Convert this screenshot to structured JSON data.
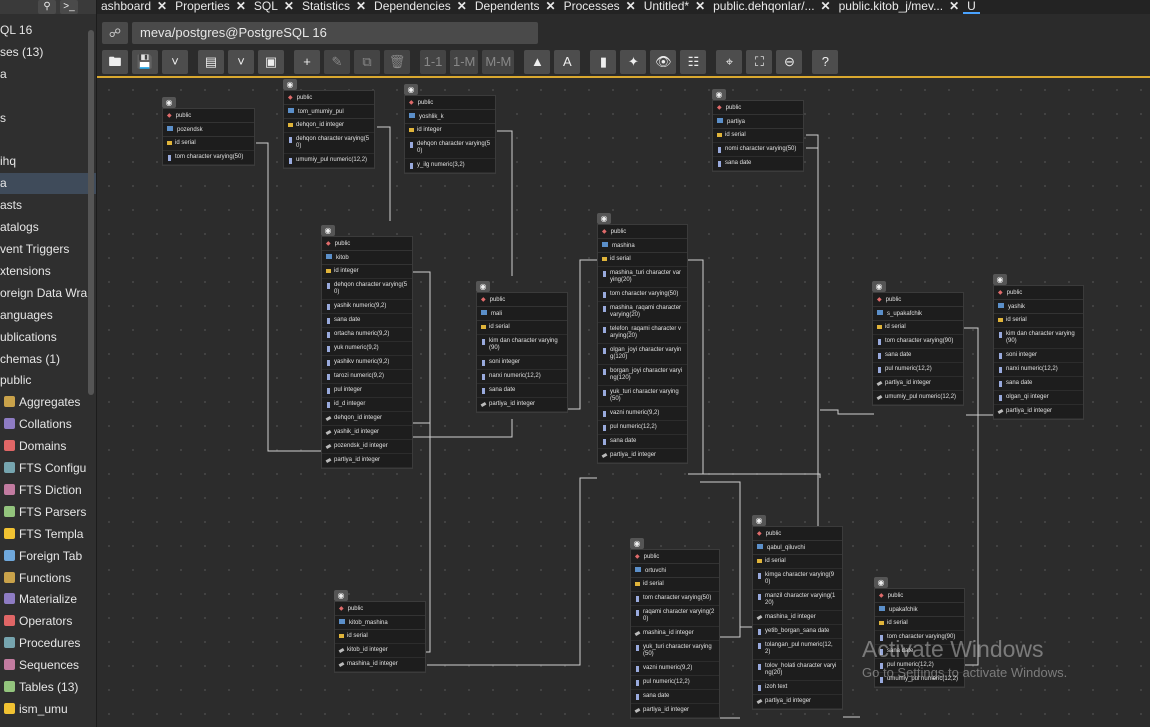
{
  "tabs": [
    {
      "label": "ashboard"
    },
    {
      "label": "Properties"
    },
    {
      "label": "SQL"
    },
    {
      "label": "Statistics"
    },
    {
      "label": "Dependencies"
    },
    {
      "label": "Dependents"
    },
    {
      "label": "Processes"
    },
    {
      "label": "Untitled*"
    },
    {
      "label": "public.dehqonlar/..."
    },
    {
      "label": "public.kitob_j/mev..."
    },
    {
      "label": "U"
    }
  ],
  "connection": "meva/postgres@PostgreSQL 16",
  "toolbar": {
    "one_one": "1-1",
    "one_many": "1-M",
    "many_many": "M-M",
    "help": "?"
  },
  "tree": [
    "QL 16",
    "ses (13)",
    "a",
    "",
    "s",
    "",
    "ihq",
    "a",
    "asts",
    "atalogs",
    "vent Triggers",
    "xtensions",
    "oreign Data Wra",
    "anguages",
    "ublications",
    "chemas (1)",
    "public",
    "Aggregates",
    "Collations",
    "Domains",
    "FTS Configu",
    "FTS Diction",
    "FTS Parsers",
    "FTS Templa",
    "Foreign Tab",
    "Functions",
    "Materialize",
    "Operators",
    "Procedures",
    "Sequences",
    "Tables (13)",
    "ism_umu"
  ],
  "tables": [
    {
      "id": "t1",
      "schema": "public",
      "name": "pozendsk",
      "cols": [
        {
          "n": "id serial",
          "k": "pk"
        },
        {
          "n": "tom character varying(50)",
          "k": ""
        }
      ]
    },
    {
      "id": "t2",
      "schema": "public",
      "name": "tom_umumiy_pul",
      "cols": [
        {
          "n": "dehqon_id integer",
          "k": "pk"
        },
        {
          "n": "dehqon character varying(50)",
          "k": ""
        },
        {
          "n": "umumiy_pul numeric(12,2)",
          "k": ""
        }
      ]
    },
    {
      "id": "t3",
      "schema": "public",
      "name": "yoshlik_k",
      "cols": [
        {
          "n": "id integer",
          "k": "pk"
        },
        {
          "n": "dehqon character varying(50)",
          "k": ""
        },
        {
          "n": "y_ilg numeric(3,2)",
          "k": ""
        }
      ]
    },
    {
      "id": "t4",
      "schema": "public",
      "name": "partiya",
      "cols": [
        {
          "n": "id serial",
          "k": "pk"
        },
        {
          "n": "nomi character varying(50)",
          "k": ""
        },
        {
          "n": "sana date",
          "k": ""
        }
      ]
    },
    {
      "id": "t5",
      "schema": "public",
      "name": "kitob",
      "cols": [
        {
          "n": "id integer",
          "k": "pk"
        },
        {
          "n": "dehqon character varying(50)",
          "k": ""
        },
        {
          "n": "yashik numeric(9,2)",
          "k": ""
        },
        {
          "n": "sana date",
          "k": ""
        },
        {
          "n": "ortacha numeric(9,2)",
          "k": ""
        },
        {
          "n": "yuk numeric(9,2)",
          "k": ""
        },
        {
          "n": "yashikv numeric(9,2)",
          "k": ""
        },
        {
          "n": "tarozi numeric(9,2)",
          "k": ""
        },
        {
          "n": "pul integer",
          "k": ""
        },
        {
          "n": "id_d integer",
          "k": ""
        },
        {
          "n": "dehqon_id integer",
          "k": "fk"
        },
        {
          "n": "yashik_id integer",
          "k": "fk"
        },
        {
          "n": "pozendsk_id integer",
          "k": "fk"
        },
        {
          "n": "partiya_id integer",
          "k": "fk"
        }
      ]
    },
    {
      "id": "t6",
      "schema": "public",
      "name": "mali",
      "cols": [
        {
          "n": "id serial",
          "k": "pk"
        },
        {
          "n": "kim dan character varying(90)",
          "k": ""
        },
        {
          "n": "soni integer",
          "k": ""
        },
        {
          "n": "narxi numeric(12,2)",
          "k": ""
        },
        {
          "n": "sana date",
          "k": ""
        },
        {
          "n": "partiya_id integer",
          "k": "fk"
        }
      ]
    },
    {
      "id": "t7",
      "schema": "public",
      "name": "mashina",
      "cols": [
        {
          "n": "id serial",
          "k": "pk"
        },
        {
          "n": "mashina_turi character varying(20)",
          "k": ""
        },
        {
          "n": "tom character varying(50)",
          "k": ""
        },
        {
          "n": "mashina_raqami character varying(20)",
          "k": ""
        },
        {
          "n": "telefon_raqami character varying(20)",
          "k": ""
        },
        {
          "n": "olgan_joyi character varying(120)",
          "k": ""
        },
        {
          "n": "borgan_joyi character varying(120)",
          "k": ""
        },
        {
          "n": "yuk_turi character varying(50)",
          "k": ""
        },
        {
          "n": "vazni numeric(9,2)",
          "k": ""
        },
        {
          "n": "pul numeric(12,2)",
          "k": ""
        },
        {
          "n": "sana date",
          "k": ""
        },
        {
          "n": "partiya_id integer",
          "k": "fk"
        }
      ]
    },
    {
      "id": "t8",
      "schema": "public",
      "name": "s_upakafchik",
      "cols": [
        {
          "n": "id serial",
          "k": "pk"
        },
        {
          "n": "tom character varying(90)",
          "k": ""
        },
        {
          "n": "sana date",
          "k": ""
        },
        {
          "n": "pul numeric(12,2)",
          "k": ""
        },
        {
          "n": "partiya_id integer",
          "k": "fk"
        },
        {
          "n": "umumiy_pul numeric(12,2)",
          "k": "fk"
        }
      ]
    },
    {
      "id": "t9",
      "schema": "public",
      "name": "yashik",
      "cols": [
        {
          "n": "id serial",
          "k": "pk"
        },
        {
          "n": "kim dan character varying(90)",
          "k": ""
        },
        {
          "n": "soni integer",
          "k": ""
        },
        {
          "n": "narxi numeric(12,2)",
          "k": ""
        },
        {
          "n": "sana date",
          "k": ""
        },
        {
          "n": "olgan_qi integer",
          "k": ""
        },
        {
          "n": "partiya_id integer",
          "k": "fk"
        }
      ]
    },
    {
      "id": "t10",
      "schema": "public",
      "name": "kitob_mashina",
      "cols": [
        {
          "n": "id serial",
          "k": "pk"
        },
        {
          "n": "kitob_id integer",
          "k": "fk"
        },
        {
          "n": "mashina_id integer",
          "k": "fk"
        }
      ]
    },
    {
      "id": "t11",
      "schema": "public",
      "name": "ortuvchi",
      "cols": [
        {
          "n": "id serial",
          "k": "pk"
        },
        {
          "n": "tom character varying(50)",
          "k": ""
        },
        {
          "n": "raqami character varying(20)",
          "k": ""
        },
        {
          "n": "mashina_id integer",
          "k": "fk"
        },
        {
          "n": "yuk_turi character varying(50)",
          "k": ""
        },
        {
          "n": "vazni numeric(9,2)",
          "k": ""
        },
        {
          "n": "pul numeric(12,2)",
          "k": ""
        },
        {
          "n": "sana date",
          "k": ""
        },
        {
          "n": "partiya_id integer",
          "k": "fk"
        }
      ]
    },
    {
      "id": "t12",
      "schema": "public",
      "name": "qabul_qiluvchi",
      "cols": [
        {
          "n": "id serial",
          "k": "pk"
        },
        {
          "n": "kimga character varying(90)",
          "k": ""
        },
        {
          "n": "manzil character varying(120)",
          "k": ""
        },
        {
          "n": "mashina_id integer",
          "k": "fk"
        },
        {
          "n": "yetib_borgan_sana date",
          "k": ""
        },
        {
          "n": "tolangan_pul numeric(12,2)",
          "k": ""
        },
        {
          "n": "tolov_holati character varying(20)",
          "k": ""
        },
        {
          "n": "izoh text",
          "k": ""
        },
        {
          "n": "partiya_id integer",
          "k": "fk"
        }
      ]
    },
    {
      "id": "t13",
      "schema": "public",
      "name": "upakafchik",
      "cols": [
        {
          "n": "id serial",
          "k": "pk"
        },
        {
          "n": "tom character varying(90)",
          "k": ""
        },
        {
          "n": "sana date",
          "k": ""
        },
        {
          "n": "pul numeric(12,2)",
          "k": ""
        },
        {
          "n": "umumiy_pul numeric(12,2)",
          "k": ""
        }
      ]
    }
  ],
  "watermark": {
    "title": "Activate Windows",
    "subtitle": "Go to Settings to activate Windows."
  }
}
